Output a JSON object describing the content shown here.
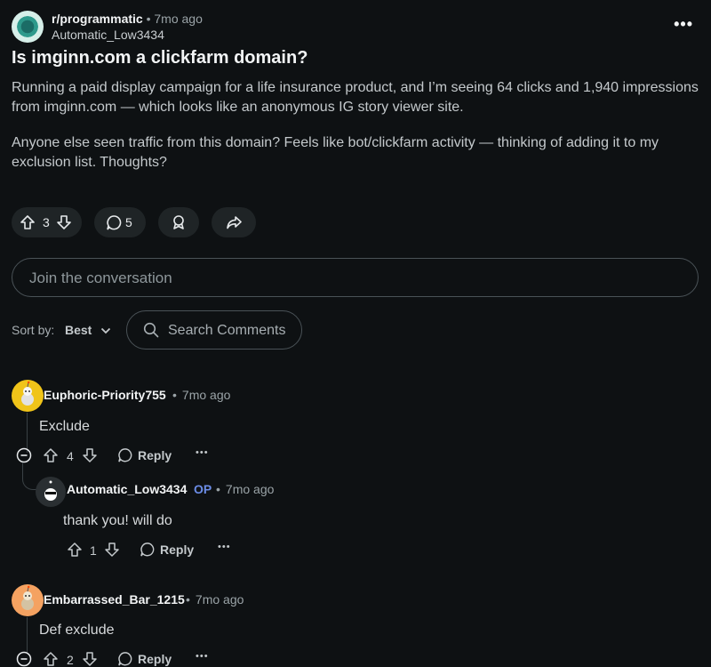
{
  "post": {
    "subreddit": "r/programmatic",
    "time": "7mo ago",
    "author": "Automatic_Low3434",
    "more": "•••",
    "title": "Is imginn.com a clickfarm domain?",
    "body": [
      "Running a paid display campaign for a life insurance product, and I’m seeing 64 clicks and 1,940 impressions from imginn.com — which looks like an anonymous IG story viewer site.",
      "Anyone else seen traffic from this domain? Feels like bot/clickfarm activity — thinking of adding it to my exclusion list. Thoughts?"
    ],
    "votes": "3",
    "comments": "5"
  },
  "join_placeholder": "Join the conversation",
  "sort": {
    "label": "Sort by:",
    "value": "Best"
  },
  "search_placeholder": "Search Comments",
  "comments": [
    {
      "author": "Euphoric-Priority755",
      "time": "7mo ago",
      "text": "Exclude",
      "votes": "4",
      "reply": "Reply",
      "more": "•••"
    },
    {
      "author": "Automatic_Low3434",
      "op": "OP",
      "time": "7mo ago",
      "text": "thank you! will do",
      "votes": "1",
      "reply": "Reply",
      "more": "•••"
    },
    {
      "author": "Embarrassed_Bar_1215",
      "time": "7mo ago",
      "text": "Def exclude",
      "votes": "2",
      "reply": "Reply",
      "more": "•••"
    }
  ],
  "colors": {
    "background": "#0e1113",
    "op": "#6b8ce6",
    "avatar1": "#f0c419",
    "avatar3": "#f4a261"
  }
}
